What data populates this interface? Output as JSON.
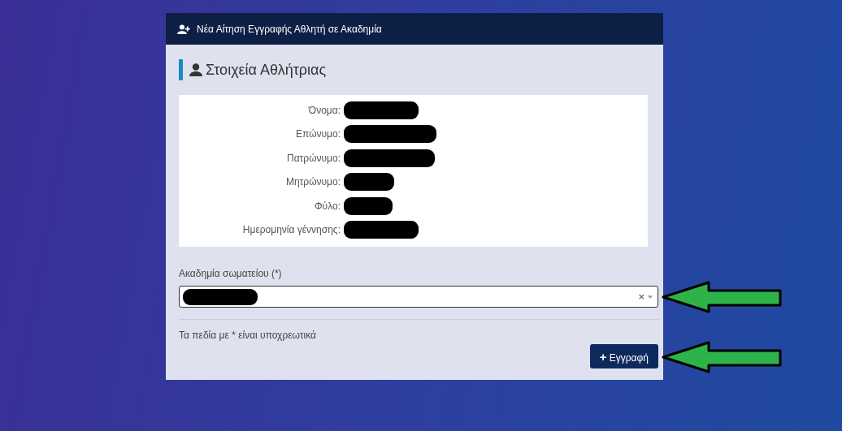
{
  "window": {
    "title": "Νέα Αίτηση Εγγραφής Αθλητή σε Ακαδημία"
  },
  "section": {
    "title": "Στοιχεία Αθλήτριας"
  },
  "fields": [
    {
      "label": "Όνομα:",
      "redacted": true
    },
    {
      "label": "Επώνυμο:",
      "redacted": true
    },
    {
      "label": "Πατρώνυμο:",
      "redacted": true
    },
    {
      "label": "Μητρώνυμο:",
      "redacted": true
    },
    {
      "label": "Φύλο:",
      "redacted": true
    },
    {
      "label": "Ημερομηνία γέννησης:",
      "redacted": true
    }
  ],
  "academy_select": {
    "label": "Ακαδημία σωματείου (*)",
    "value_redacted": true,
    "clear": "×",
    "annotated": true
  },
  "required_note": "Τα πεδία με * είναι υποχρεωτικά",
  "submit_button": {
    "icon": "+",
    "label": "Εγγραφή",
    "annotated": true
  }
}
